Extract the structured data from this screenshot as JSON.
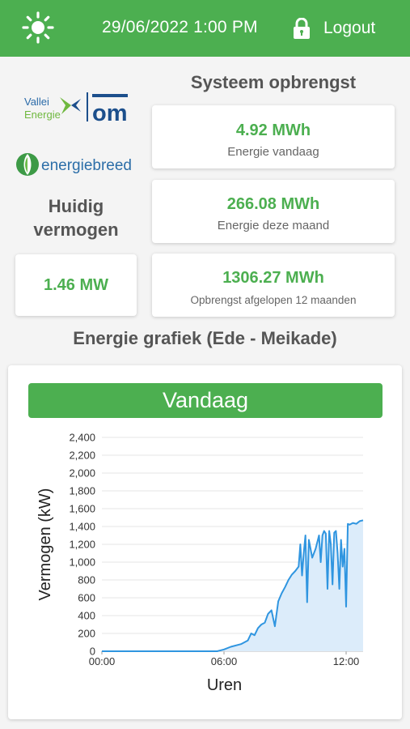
{
  "header": {
    "datetime": "29/06/2022 1:00 PM",
    "logout_label": "Logout",
    "theme_icon": "sun-icon",
    "logout_icon": "lock-icon"
  },
  "logos": {
    "vallei_line1": "Vallei",
    "vallei_line2": "Energie",
    "om_text": "om",
    "energiebreed_part1": "energie",
    "energiebreed_part2": "breed"
  },
  "current_power": {
    "title": "Huidig vermogen",
    "value": "1.46 MW"
  },
  "system_yield": {
    "title": "Systeem opbrengst",
    "cards": [
      {
        "value": "4.92 MWh",
        "label": "Energie vandaag"
      },
      {
        "value": "266.08 MWh",
        "label": "Energie deze maand"
      },
      {
        "value": "1306.27 MWh",
        "label": "Opbrengst afgelopen 12 maanden"
      }
    ]
  },
  "graph": {
    "title": "Energie grafiek (Ede - Meikade)",
    "period_label": "Vandaag"
  },
  "colors": {
    "brand_green": "#4caf50",
    "line_blue": "#2f95e0",
    "area_blue": "#dcecfa"
  },
  "chart_data": {
    "type": "area",
    "xlabel": "Uren",
    "ylabel": "Vermogen (kW)",
    "xlim": [
      "00:00",
      "12:50"
    ],
    "ylim": [
      0,
      2400
    ],
    "x_ticks": [
      "00:00",
      "06:00",
      "12:00"
    ],
    "y_ticks": [
      "0",
      "200",
      "400",
      "600",
      "800",
      "1,000",
      "1,200",
      "1,400",
      "1,600",
      "1,800",
      "2,000",
      "2,200",
      "2,400"
    ],
    "grid": true,
    "series": [
      {
        "x": [
          "00:00",
          "05:00",
          "05:40",
          "06:00",
          "06:20",
          "06:50",
          "07:10",
          "07:20",
          "07:30",
          "07:40",
          "07:50",
          "08:00",
          "08:10",
          "08:20",
          "08:30",
          "08:40",
          "08:50",
          "09:00",
          "09:10",
          "09:20",
          "09:30",
          "09:40",
          "09:45",
          "09:50",
          "09:55",
          "10:00",
          "10:05",
          "10:10",
          "10:20",
          "10:30",
          "10:40",
          "10:45",
          "10:50",
          "10:55",
          "11:00",
          "11:05",
          "11:10",
          "11:15",
          "11:20",
          "11:25",
          "11:30",
          "11:35",
          "11:40",
          "11:45",
          "11:50",
          "11:55",
          "12:00",
          "12:05",
          "12:10",
          "12:20",
          "12:30",
          "12:40",
          "12:50"
        ],
        "y": [
          0,
          0,
          0,
          20,
          50,
          80,
          120,
          200,
          180,
          260,
          300,
          320,
          420,
          460,
          280,
          560,
          650,
          720,
          800,
          860,
          900,
          950,
          1200,
          850,
          1100,
          1300,
          550,
          1250,
          1050,
          1150,
          1300,
          1000,
          1300,
          1350,
          1320,
          700,
          1350,
          1200,
          750,
          1330,
          1350,
          1100,
          700,
          1250,
          950,
          1150,
          500,
          1430,
          1420,
          1440,
          1430,
          1460,
          1470
        ]
      }
    ]
  }
}
